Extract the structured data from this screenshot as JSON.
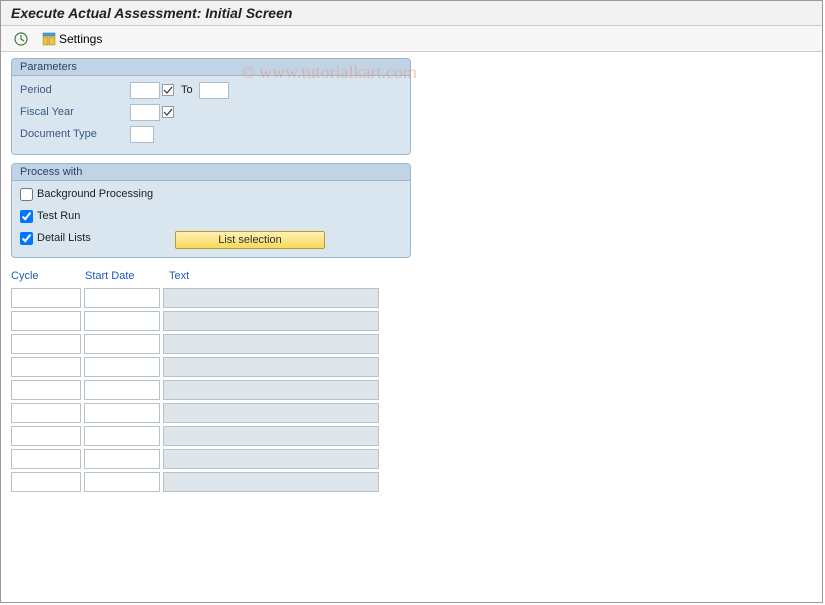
{
  "title": "Execute Actual Assessment: Initial Screen",
  "toolbar": {
    "settings_label": "Settings"
  },
  "watermark": "© www.tutorialkart.com",
  "parameters": {
    "group_title": "Parameters",
    "period_label": "Period",
    "period_to_label": "To",
    "period_from": "",
    "period_to": "",
    "fiscal_year_label": "Fiscal Year",
    "fiscal_year_value": "",
    "doc_type_label": "Document Type",
    "doc_type_value": ""
  },
  "process": {
    "group_title": "Process with",
    "bg_label": "Background Processing",
    "bg_checked": false,
    "test_label": "Test Run",
    "test_checked": true,
    "detail_label": "Detail Lists",
    "detail_checked": true,
    "list_selection_label": "List selection"
  },
  "table": {
    "headers": {
      "cycle": "Cycle",
      "start_date": "Start Date",
      "text": "Text"
    },
    "rows": [
      {
        "cycle": "",
        "start_date": "",
        "text": ""
      },
      {
        "cycle": "",
        "start_date": "",
        "text": ""
      },
      {
        "cycle": "",
        "start_date": "",
        "text": ""
      },
      {
        "cycle": "",
        "start_date": "",
        "text": ""
      },
      {
        "cycle": "",
        "start_date": "",
        "text": ""
      },
      {
        "cycle": "",
        "start_date": "",
        "text": ""
      },
      {
        "cycle": "",
        "start_date": "",
        "text": ""
      },
      {
        "cycle": "",
        "start_date": "",
        "text": ""
      },
      {
        "cycle": "",
        "start_date": "",
        "text": ""
      }
    ]
  }
}
